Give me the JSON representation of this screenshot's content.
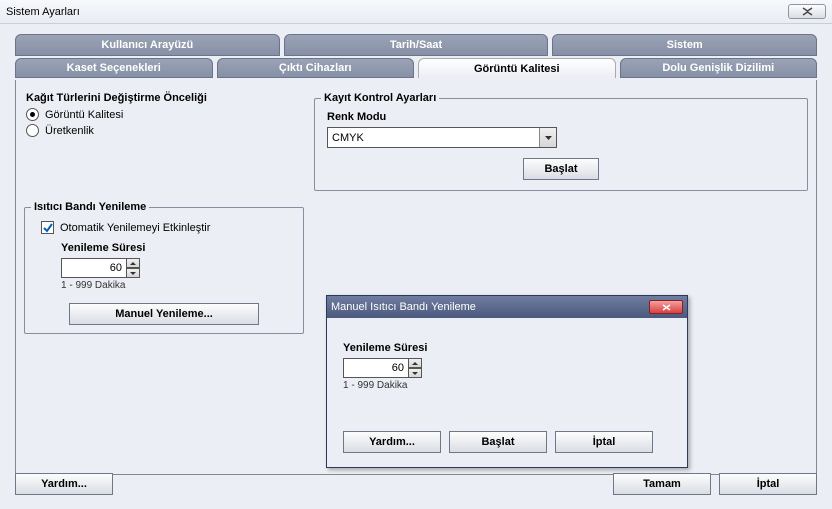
{
  "window": {
    "title": "Sistem Ayarları"
  },
  "tabs_main": [
    {
      "label": "Kullanıcı Arayüzü"
    },
    {
      "label": "Tarih/Saat"
    },
    {
      "label": "Sistem"
    }
  ],
  "tabs_sub": [
    {
      "label": "Kaset Seçenekleri"
    },
    {
      "label": "Çıktı Cihazları"
    },
    {
      "label": "Görüntü Kalitesi"
    },
    {
      "label": "Dolu Genişlik Dizilimi"
    }
  ],
  "priority": {
    "title": "Kağıt Türlerini Değiştirme Önceliği",
    "opt1": "Görüntü Kalitesi",
    "opt2": "Üretkenlik"
  },
  "reg_ctrl": {
    "legend": "Kayıt Kontrol Ayarları",
    "mode_label": "Renk Modu",
    "mode_value": "CMYK",
    "start": "Başlat"
  },
  "fuser": {
    "legend": "Isıtıcı Bandı Yenileme",
    "auto_enable": "Otomatik Yenilemeyi Etkinleştir",
    "timing_label": "Yenileme Süresi",
    "timing_value": "60",
    "hint": "1 - 999 Dakika",
    "manual_btn": "Manuel Yenileme..."
  },
  "modal": {
    "title": "Manuel Isıtıcı Bandı Yenileme",
    "timing_label": "Yenileme Süresi",
    "timing_value": "60",
    "hint": "1 - 999 Dakika",
    "help": "Yardım...",
    "start": "Başlat",
    "cancel": "İptal"
  },
  "footer": {
    "help": "Yardım...",
    "ok": "Tamam",
    "cancel": "İptal"
  }
}
